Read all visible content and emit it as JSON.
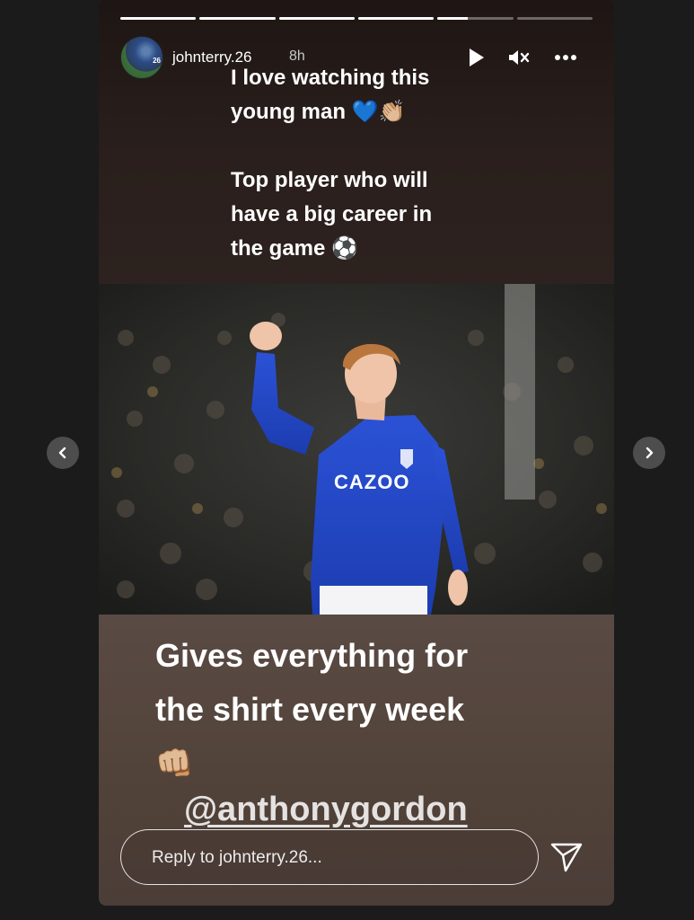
{
  "story": {
    "username": "johnterry.26",
    "time": "8h",
    "progress_segments": [
      1,
      1,
      1,
      1,
      0.4,
      0
    ],
    "colors": {
      "background": "#1b1b1b",
      "top_band": "#2a1f1c",
      "bottom_band": "#544640",
      "accent_heart": "#2f7ad8"
    }
  },
  "header": {
    "play_icon": "play-icon",
    "mute_icon": "muted-speaker-icon",
    "more_icon": "more-horizontal-icon",
    "avatar_number": "26"
  },
  "top_text": {
    "line1": "I love watching this",
    "line2": "young man 💙👏🏼",
    "line3": "Top player who will",
    "line4": "have a big career in",
    "line5": "the game ⚽"
  },
  "photo": {
    "shirt_sponsor": "CAZOO"
  },
  "bottom_text": {
    "line1": "Gives everything for",
    "line2": "the shirt every week",
    "line3": "👊🏼",
    "mention": "@anthonygordon"
  },
  "reply": {
    "placeholder": "Reply to johnterry.26..."
  },
  "nav": {
    "prev_icon": "chevron-left-icon",
    "next_icon": "chevron-right-icon"
  }
}
